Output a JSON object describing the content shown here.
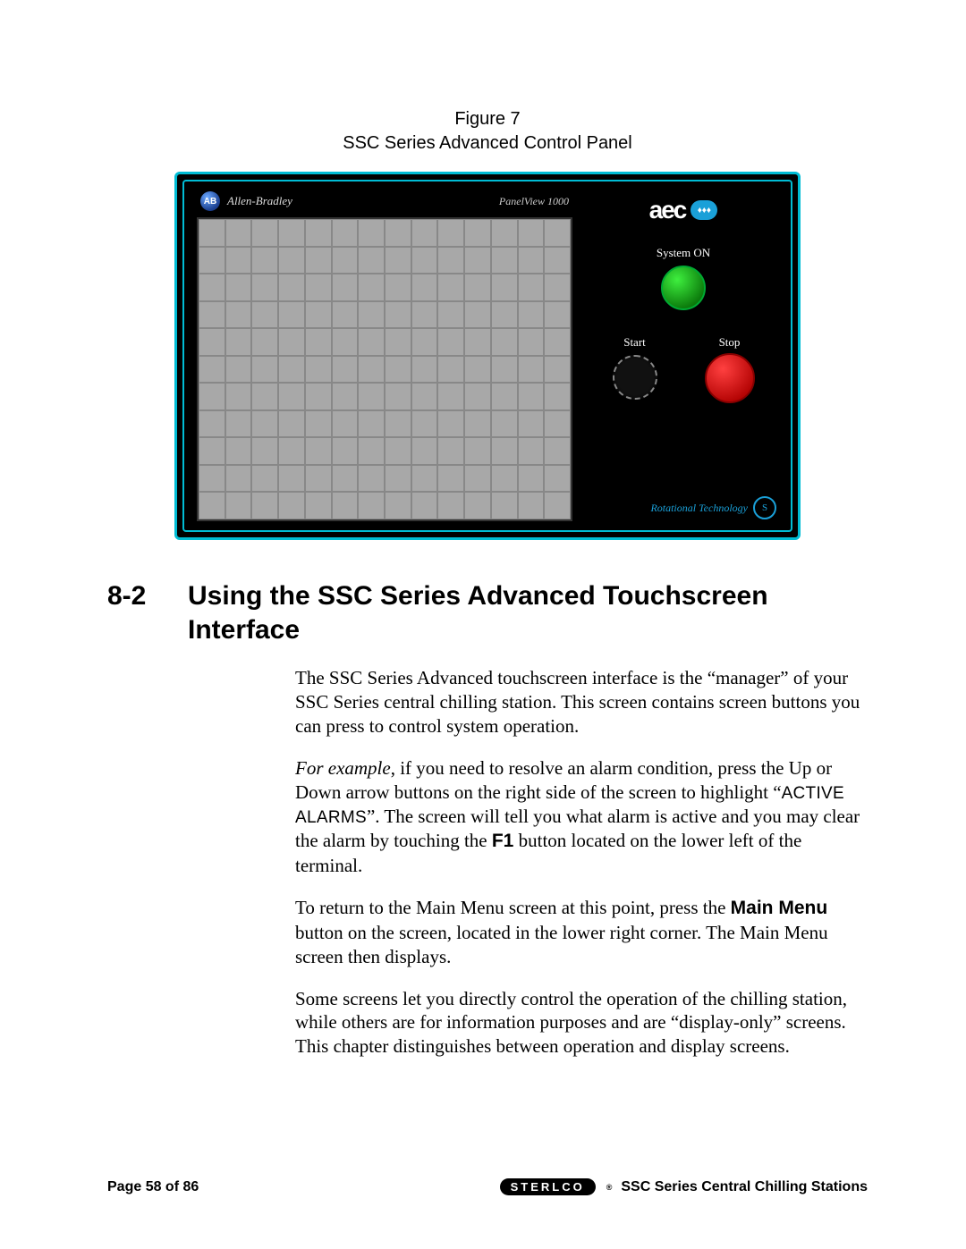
{
  "figure": {
    "label": "Figure 7",
    "title": "SSC Series Advanced Control Panel"
  },
  "panel": {
    "ab_badge": "AB",
    "ab_brand": "Allen-Bradley",
    "panelview": "PanelView 1000",
    "aec_text": "aec",
    "aec_drops": "♦♦♦",
    "system_on": "System ON",
    "start": "Start",
    "stop": "Stop",
    "rot_tech": "Rotational Technology",
    "seal": "S"
  },
  "section": {
    "number": "8-2",
    "title": "Using the SSC Series Advanced Touchscreen Interface"
  },
  "body": {
    "p1": "The SSC Series Advanced touchscreen interface is the “manager” of your SSC Series central chilling station. This screen contains screen buttons you can press to control system operation.",
    "p2_lead": "For example",
    "p2_a": ", if you need to resolve an alarm condition, press the Up or Down arrow buttons on the right side of the screen to highlight “",
    "p2_term": "ACTIVE ALARMS",
    "p2_b": "”.  The screen will tell you what alarm is active and you may clear the alarm by touching the ",
    "p2_key": "F1",
    "p2_c": " button located on the lower left of the terminal.",
    "p3_a": "To return to the Main Menu screen at this point, press the ",
    "p3_key": "Main Menu",
    "p3_b": " button on the screen, located in the lower right corner. The Main Menu screen then displays.",
    "p4": "Some screens let you directly control the operation of the chilling station, while others are for information purposes and are “display-only” screens. This chapter distinguishes between operation and display screens."
  },
  "footer": {
    "page": "Page 58 of 86",
    "brand": "STERLCO",
    "reg": "®",
    "doc": "SSC Series Central Chilling Stations"
  }
}
